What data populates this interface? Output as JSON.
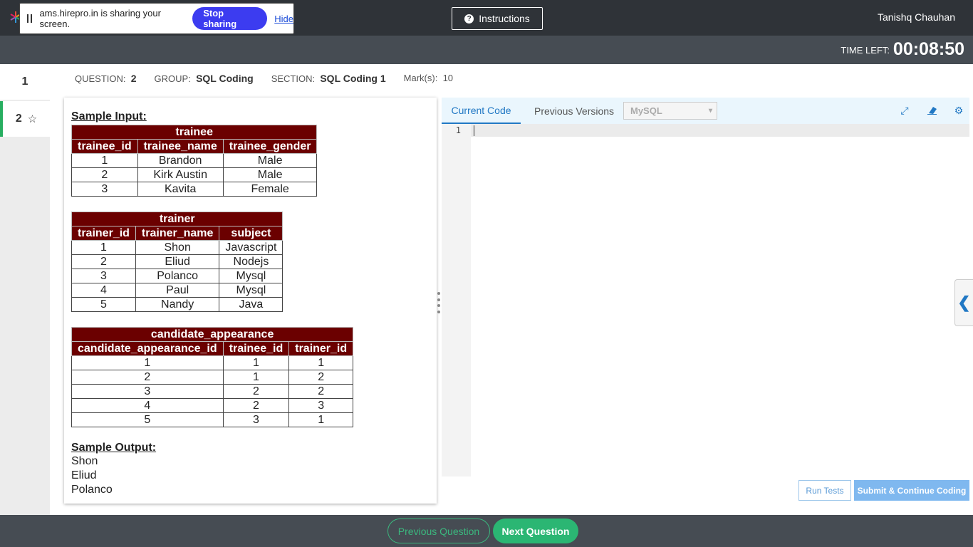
{
  "share_bar": {
    "text": "ams.hirepro.in is sharing your screen.",
    "stop_label": "Stop sharing",
    "hide_label": "Hide"
  },
  "header": {
    "instructions_label": "Instructions",
    "username": "Tanishq Chauhan",
    "time_left_label": "TIME LEFT:",
    "time_left_value": "00:08:50"
  },
  "question_nav": {
    "items": [
      {
        "number": "1"
      },
      {
        "number": "2",
        "starred": true
      }
    ]
  },
  "meta": {
    "question_label": "QUESTION:",
    "question_value": "2",
    "group_label": "GROUP:",
    "group_value": "SQL Coding",
    "section_label": "SECTION:",
    "section_value": "SQL Coding 1",
    "marks_label": "Mark(s):",
    "marks_value": "10"
  },
  "question": {
    "sample_input_label": "Sample Input:",
    "tables": [
      {
        "name": "trainee",
        "columns": [
          "trainee_id",
          "trainee_name",
          "trainee_gender"
        ],
        "rows": [
          [
            "1",
            "Brandon",
            "Male"
          ],
          [
            "2",
            "Kirk Austin",
            "Male"
          ],
          [
            "3",
            "Kavita",
            "Female"
          ]
        ]
      },
      {
        "name": "trainer",
        "columns": [
          "trainer_id",
          "trainer_name",
          "subject"
        ],
        "rows": [
          [
            "1",
            "Shon",
            "Javascript"
          ],
          [
            "2",
            "Eliud",
            "Nodejs"
          ],
          [
            "3",
            "Polanco",
            "Mysql"
          ],
          [
            "4",
            "Paul",
            "Mysql"
          ],
          [
            "5",
            "Nandy",
            "Java"
          ]
        ]
      },
      {
        "name": "candidate_appearance",
        "columns": [
          "candidate_appearance_id",
          "trainee_id",
          "trainer_id"
        ],
        "rows": [
          [
            "1",
            "1",
            "1"
          ],
          [
            "2",
            "1",
            "2"
          ],
          [
            "3",
            "2",
            "2"
          ],
          [
            "4",
            "2",
            "3"
          ],
          [
            "5",
            "3",
            "1"
          ]
        ]
      }
    ],
    "sample_output_label": "Sample Output:",
    "sample_output": [
      "Shon",
      "Eliud",
      "Polanco"
    ]
  },
  "editor": {
    "tab_current": "Current Code",
    "tab_previous": "Previous Versions",
    "language": "MySQL",
    "line_number": "1",
    "code": "",
    "run_label": "Run Tests",
    "submit_label": "Submit & Continue Coding"
  },
  "footer": {
    "prev_label": "Previous Question",
    "next_label": "Next Question"
  },
  "colors": {
    "topbar": "#2f3338",
    "table_header": "#6b0000",
    "accent_green": "#2bb673",
    "accent_blue": "#2178c4",
    "stop_button": "#3c3cf0"
  }
}
